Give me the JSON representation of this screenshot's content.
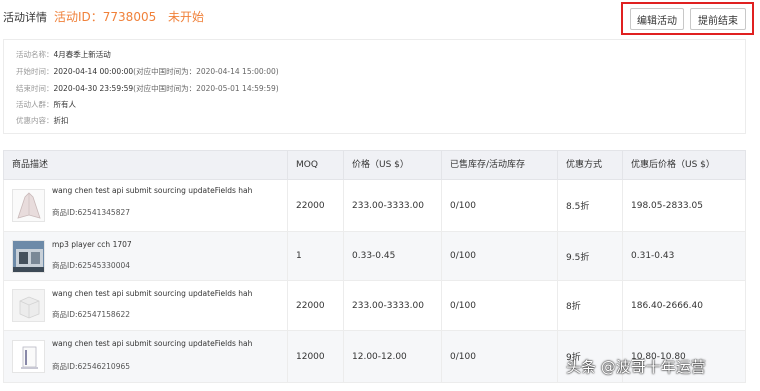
{
  "header": {
    "title": "活动详情",
    "activity_id": "活动ID：7738005",
    "status": "未开始",
    "edit_button": "编辑活动",
    "end_button": "提前结束"
  },
  "info": {
    "name_label": "活动名称：",
    "name_value": "4月春季上新活动",
    "start_label": "开始时间：",
    "start_value": "2020-04-14 00:00:00",
    "start_note": "(对应中国时间为：2020-04-14 15:00:00)",
    "end_label": "结束时间：",
    "end_value": "2020-04-30 23:59:59",
    "end_note": "(对应中国时间为：2020-05-01 14:59:59)",
    "audience_label": "活动人群：",
    "audience_value": "所有人",
    "discount_label": "优惠内容：",
    "discount_value": "折扣"
  },
  "table": {
    "headers": [
      "商品描述",
      "MOQ",
      "价格（US $）",
      "已售库存/活动库存",
      "优惠方式",
      "优惠后价格（US $）"
    ],
    "rows": [
      {
        "name": "wang chen test api submit sourcing updateFields hah",
        "id": "商品ID:62541345827",
        "moq": "22000",
        "price": "233.00-3333.00",
        "stock": "0/100",
        "discount": "8.5折",
        "final_price": "198.05-2833.05",
        "thumb": "dress-icon"
      },
      {
        "name": "mp3 player cch 1707",
        "id": "商品ID:62545330004",
        "moq": "1",
        "price": "0.33-0.45",
        "stock": "0/100",
        "discount": "9.5折",
        "final_price": "0.31-0.43",
        "thumb": "machine-photo"
      },
      {
        "name": "wang chen test api submit sourcing updateFields hah",
        "id": "商品ID:62547158622",
        "moq": "22000",
        "price": "233.00-3333.00",
        "stock": "0/100",
        "discount": "8折",
        "final_price": "186.40-2666.40",
        "thumb": "box-icon"
      },
      {
        "name": "wang chen test api submit sourcing updateFields hah",
        "id": "商品ID:62546210965",
        "moq": "12000",
        "price": "12.00-12.00",
        "stock": "0/100",
        "discount": "9折",
        "final_price": "10.80-10.80",
        "thumb": "device-icon"
      }
    ]
  },
  "watermark": "头条 @波哥十年运营"
}
